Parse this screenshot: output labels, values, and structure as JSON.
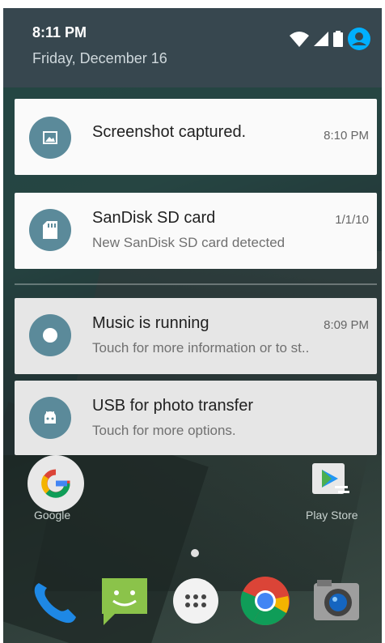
{
  "status": {
    "time": "8:11 PM",
    "date": "Friday, December 16"
  },
  "notifications": [
    {
      "title": "Screenshot captured.",
      "subtitle": "",
      "timestamp": "8:10 PM",
      "icon": "image-icon"
    },
    {
      "title": "SanDisk SD card",
      "subtitle": "New SanDisk SD card detected",
      "timestamp": "1/1/10",
      "icon": "sd-card-icon"
    },
    {
      "title": "Music is running",
      "subtitle": "Touch for more information or to st..",
      "timestamp": "8:09 PM",
      "icon": "music-icon"
    },
    {
      "title": "USB for photo transfer",
      "subtitle": "Touch for more options.",
      "timestamp": "",
      "icon": "android-icon"
    }
  ],
  "home": {
    "google_label": "Google",
    "playstore_label": "Play Store",
    "dock": [
      "phone-icon",
      "messaging-icon",
      "app-drawer-icon",
      "chrome-icon",
      "camera-icon"
    ]
  },
  "colors": {
    "status_bg": "#37474f",
    "icon_circle": "#5b8a9a",
    "accent": "#00b0ff"
  }
}
